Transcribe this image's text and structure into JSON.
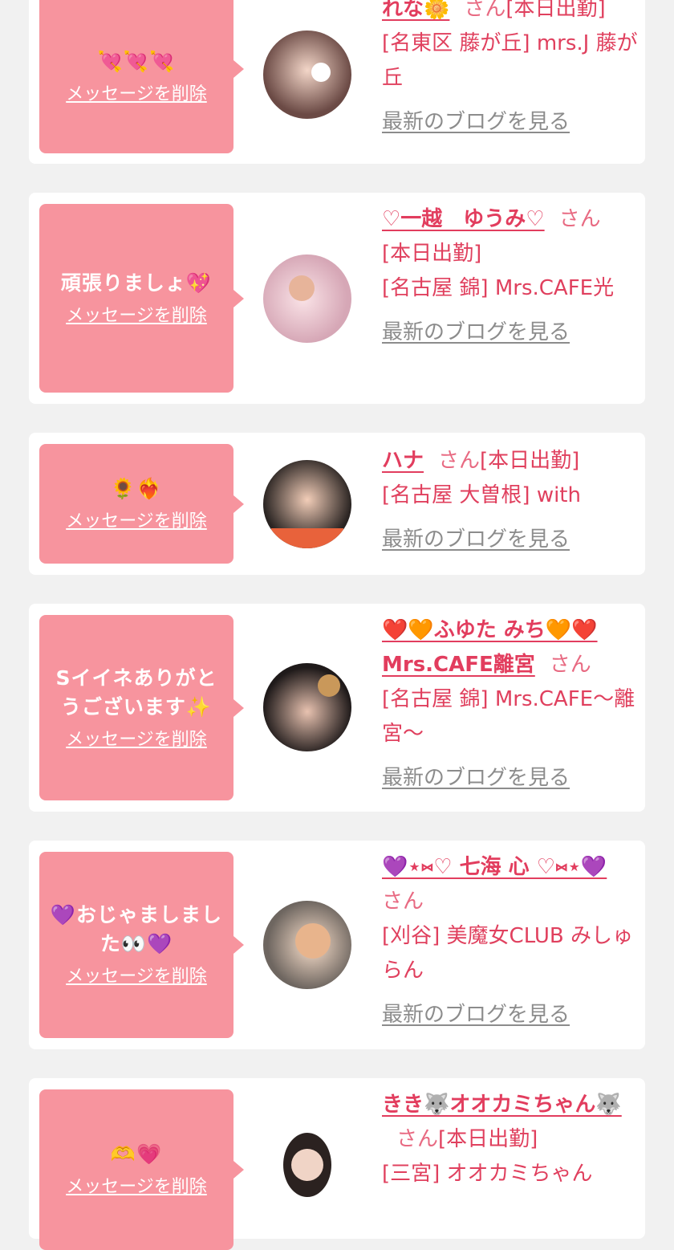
{
  "delete_label": "メッセージを削除",
  "blog_label": "最新のブログを見る",
  "san_label": "さん",
  "accent_color": "#f7949e",
  "name_color": "#e23d5e",
  "cards": [
    {
      "message": "💘💘💘",
      "name": "れな🌼",
      "status": "[本日出勤]",
      "location": "[名東区 藤が丘] mrs.J 藤が丘",
      "avatar_icon": "photo-icon"
    },
    {
      "message": "頑張りましょ💖",
      "name": "♡一越　ゆうみ♡",
      "status": "[本日出勤]",
      "location": "[名古屋 錦] Mrs.CAFE光",
      "avatar_icon": "photo-icon"
    },
    {
      "message": "🌻❤️‍🔥",
      "name": "ハナ",
      "status": "[本日出勤]",
      "location": "[名古屋 大曽根] with",
      "avatar_icon": "photo-icon"
    },
    {
      "message": "Sイイネありがとうございます✨",
      "name": "❤️🧡ふゆた みち🧡❤️Mrs.CAFE離宮",
      "status": "",
      "location": "[名古屋 錦] Mrs.CAFE〜離宮〜",
      "avatar_icon": "photo-icon"
    },
    {
      "message": "💜おじゃましました👀💜",
      "name": "💜⋆⑅♡ 七海 心 ♡⑅⋆💜",
      "status": "",
      "location": "[刈谷] 美魔女CLUB みしゅらん",
      "avatar_icon": "photo-icon"
    },
    {
      "message": "🫶💗",
      "name": "きき🐺オオカミちゃん🐺",
      "status": "[本日出勤]",
      "location": "[三宮] オオカミちゃん",
      "avatar_icon": "photo-icon"
    }
  ]
}
